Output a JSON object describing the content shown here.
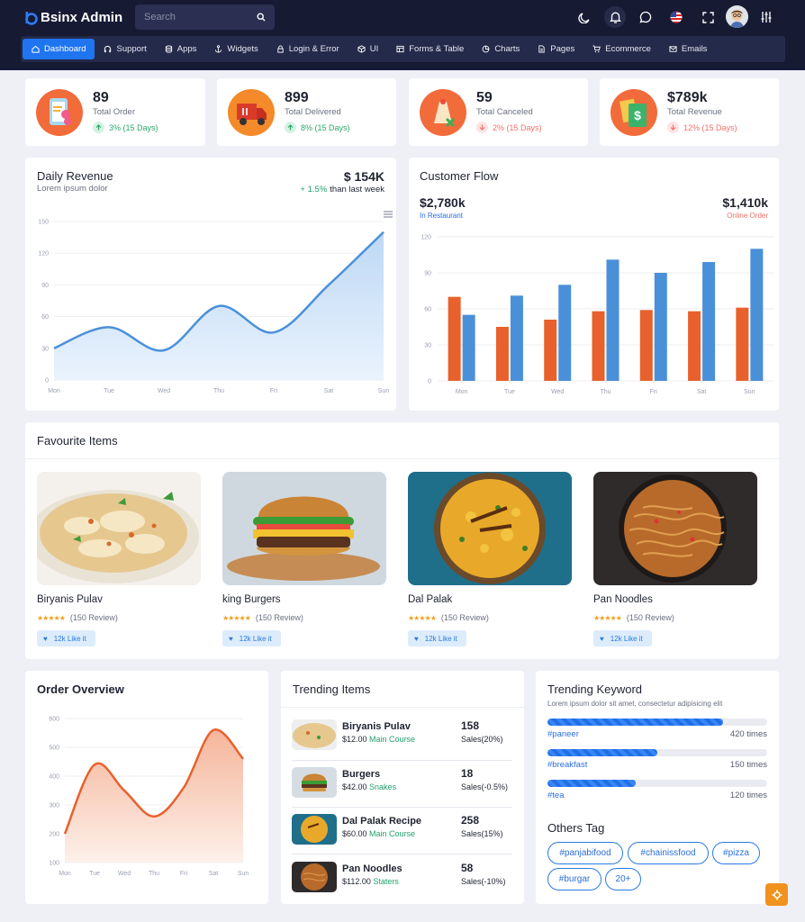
{
  "app": {
    "brand": "Bsinx Admin"
  },
  "search": {
    "placeholder": "Search"
  },
  "nav": [
    {
      "label": "Dashboard",
      "icon": "home-icon",
      "active": true
    },
    {
      "label": "Support",
      "icon": "headset-icon"
    },
    {
      "label": "Apps",
      "icon": "database-icon"
    },
    {
      "label": "Widgets",
      "icon": "anchor-icon"
    },
    {
      "label": "Login & Error",
      "icon": "lock-icon"
    },
    {
      "label": "UI",
      "icon": "cube-icon"
    },
    {
      "label": "Forms & Table",
      "icon": "table-icon"
    },
    {
      "label": "Charts",
      "icon": "pie-icon"
    },
    {
      "label": "Pages",
      "icon": "file-icon"
    },
    {
      "label": "Ecommerce",
      "icon": "cart-icon"
    },
    {
      "label": "Emails",
      "icon": "mail-icon"
    }
  ],
  "stats": [
    {
      "value": "89",
      "label": "Total Order",
      "change": "3% (15 Days)",
      "trend": "up",
      "icon": "order-clipboard-icon"
    },
    {
      "value": "899",
      "label": "Total Delivered",
      "change": "8% (15 Days)",
      "trend": "up",
      "icon": "delivery-truck-icon"
    },
    {
      "value": "59",
      "label": "Total Canceled",
      "change": "2% (15 Days)",
      "trend": "down",
      "icon": "canceled-bag-icon"
    },
    {
      "value": "$789k",
      "label": "Total Revenue",
      "change": "12% (15 Days)",
      "trend": "down",
      "icon": "revenue-cash-icon"
    }
  ],
  "daily_revenue": {
    "title": "Daily Revenue",
    "subtitle": "Lorem ipsum dolor",
    "amount": "$ 154K",
    "change": "+ 1.5%",
    "change_text": "than last week"
  },
  "customer_flow": {
    "title": "Customer Flow",
    "restaurant_value": "$2,780k",
    "restaurant_label": "In Restaurant",
    "online_value": "$1,410k",
    "online_label": "Online Order"
  },
  "favourites": {
    "title": "Favourite Items",
    "items": [
      {
        "name": "Biryanis Pulav",
        "reviews": "(150 Review)",
        "likes": "12k Like it"
      },
      {
        "name": "king Burgers",
        "reviews": "(150 Review)",
        "likes": "12k Like it"
      },
      {
        "name": "Dal Palak",
        "reviews": "(150 Review)",
        "likes": "12k Like it"
      },
      {
        "name": "Pan Noodles",
        "reviews": "(150 Review)",
        "likes": "12k Like it"
      }
    ]
  },
  "order_overview": {
    "title": "Order Overview"
  },
  "trending_items": {
    "title": "Trending Items",
    "items": [
      {
        "name": "Biryanis Pulav",
        "price": "$12.00",
        "category": "Main Course",
        "count": "158",
        "sales": "Sales(20%)"
      },
      {
        "name": "Burgers",
        "price": "$42.00",
        "category": "Snakes",
        "count": "18",
        "sales": "Sales(-0.5%)"
      },
      {
        "name": "Dal Palak Recipe",
        "price": "$60.00",
        "category": "Main Course",
        "count": "258",
        "sales": "Sales(15%)"
      },
      {
        "name": "Pan Noodles",
        "price": "$112.00",
        "category": "Staters",
        "count": "58",
        "sales": "Sales(-10%)"
      }
    ]
  },
  "trending_keyword": {
    "title": "Trending Keyword",
    "subtitle": "Lorem ipsum dolor sit amet, consectetur adipisicing elit",
    "keywords": [
      {
        "name": "#paneer",
        "times": "420 times",
        "level": 0.8
      },
      {
        "name": "#breakfast",
        "times": "150 times",
        "level": 0.5
      },
      {
        "name": "#tea",
        "times": "120 times",
        "level": 0.4
      }
    ],
    "tags_title": "Others Tag",
    "tags": [
      "#panjabifood",
      "#chainissfood",
      "#pizza",
      "#burgar",
      "20+"
    ]
  },
  "colors": {
    "accent": "#1f75f0",
    "orange": "#e8612c",
    "blue": "#4a90d9",
    "green": "#22a06b",
    "red": "#f2706a"
  },
  "chart_data": [
    {
      "type": "area",
      "title": "Daily Revenue",
      "categories": [
        "Mon",
        "Tue",
        "Wed",
        "Thu",
        "Fri",
        "Sat",
        "Sun"
      ],
      "values": [
        30,
        50,
        28,
        70,
        45,
        90,
        140
      ],
      "ylim": [
        0,
        150
      ],
      "yticks": [
        0,
        30,
        60,
        90,
        120,
        150
      ]
    },
    {
      "type": "bar",
      "title": "Customer Flow",
      "categories": [
        "Mon",
        "Tue",
        "Wed",
        "Thu",
        "Fri",
        "Sat",
        "Sun"
      ],
      "series": [
        {
          "values": [
            70,
            45,
            51,
            58,
            59,
            58,
            61
          ],
          "color": "#e8612c"
        },
        {
          "values": [
            55,
            71,
            80,
            101,
            90,
            99,
            110
          ],
          "color": "#4a90d9"
        }
      ],
      "ylim": [
        0,
        120
      ],
      "yticks": [
        0,
        30,
        60,
        90,
        120
      ]
    },
    {
      "type": "area",
      "title": "Order Overview",
      "categories": [
        "Mon",
        "Tue",
        "Wed",
        "Thu",
        "Fri",
        "Sat",
        "Sun"
      ],
      "values": [
        200,
        440,
        350,
        260,
        360,
        560,
        460
      ],
      "ylim": [
        100,
        600
      ],
      "yticks": [
        100,
        200,
        300,
        400,
        500,
        600
      ]
    }
  ]
}
